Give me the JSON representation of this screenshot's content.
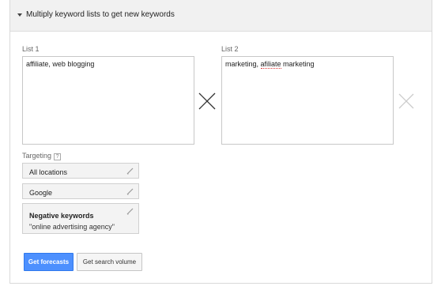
{
  "header": {
    "title": "Multiply keyword lists to get new keywords"
  },
  "list1": {
    "label": "List 1",
    "value": "affiliate, web blogging"
  },
  "list2": {
    "label": "List 2",
    "value_prefix": "marketing, ",
    "value_misspelled": "afiliate",
    "value_suffix": " marketing"
  },
  "targeting": {
    "label": "Targeting",
    "help": "?",
    "location": "All locations",
    "network": "Google",
    "negative_title": "Negative keywords",
    "negative_value": "\"online advertising agency\""
  },
  "actions": {
    "forecast_label": "Get forecasts",
    "volume_label": "Get search volume"
  },
  "icons": {
    "multiply": "multiply-icon",
    "remove": "close-icon",
    "edit": "pencil-icon",
    "expand": "caret-down-icon"
  },
  "colors": {
    "primary_button": "#4d90fe",
    "remove_icon": "#cccccc"
  }
}
